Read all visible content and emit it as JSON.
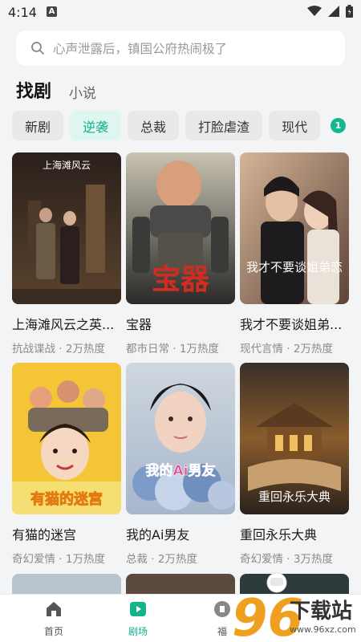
{
  "status": {
    "time": "4:14",
    "notif_icon": "A"
  },
  "search": {
    "placeholder": "心声泄露后，镇国公府热闹极了"
  },
  "main_tabs": [
    {
      "label": "找剧",
      "active": true
    },
    {
      "label": "小说",
      "active": false
    }
  ],
  "chips": [
    {
      "label": "新剧",
      "active": false
    },
    {
      "label": "逆袭",
      "active": true
    },
    {
      "label": "总裁",
      "active": false
    },
    {
      "label": "打脸虐渣",
      "active": false
    },
    {
      "label": "现代",
      "active": false
    }
  ],
  "chip_badge": "1",
  "cards": [
    {
      "title": "上海滩风云之英...",
      "meta": "抗战谍战 · 2万热度",
      "poster_text": "上海滩风云",
      "colors": [
        "#3a2a22",
        "#7a5a3a"
      ]
    },
    {
      "title": "宝器",
      "meta": "都市日常 · 1万热度",
      "poster_text": "宝器",
      "colors": [
        "#3d3c3a",
        "#8a7a60"
      ]
    },
    {
      "title": "我才不要谈姐弟...",
      "meta": "现代言情 · 2万热度",
      "poster_text": "我才不要谈姐弟恋",
      "colors": [
        "#c9a88e",
        "#3b3030"
      ]
    },
    {
      "title": "有猫的迷宫",
      "meta": "奇幻爱情 · 1万热度",
      "poster_text": "有猫的迷宫",
      "colors": [
        "#f2c53a",
        "#f7e27a"
      ]
    },
    {
      "title": "我的Ai男友",
      "meta": "总裁 · 2万热度",
      "poster_text": "我的Ai男友",
      "colors": [
        "#9bb8d4",
        "#d8c2c8"
      ]
    },
    {
      "title": "重回永乐大典",
      "meta": "奇幻爱情 · 3万热度",
      "poster_text": "重回永乐大典",
      "colors": [
        "#2c2620",
        "#9a6a34"
      ]
    }
  ],
  "bottom_nav": [
    {
      "label": "首页",
      "icon": "home-icon",
      "active": false
    },
    {
      "label": "剧场",
      "icon": "play-icon",
      "active": true
    },
    {
      "label": "福",
      "icon": "gift-icon",
      "active": false
    }
  ],
  "watermark": {
    "number": "96",
    "text": "下载站",
    "url": "www.96xz.com"
  },
  "colors": {
    "accent": "#14b48c",
    "chip_active_bg": "#dff5ef",
    "background": "#f3f4f6"
  }
}
